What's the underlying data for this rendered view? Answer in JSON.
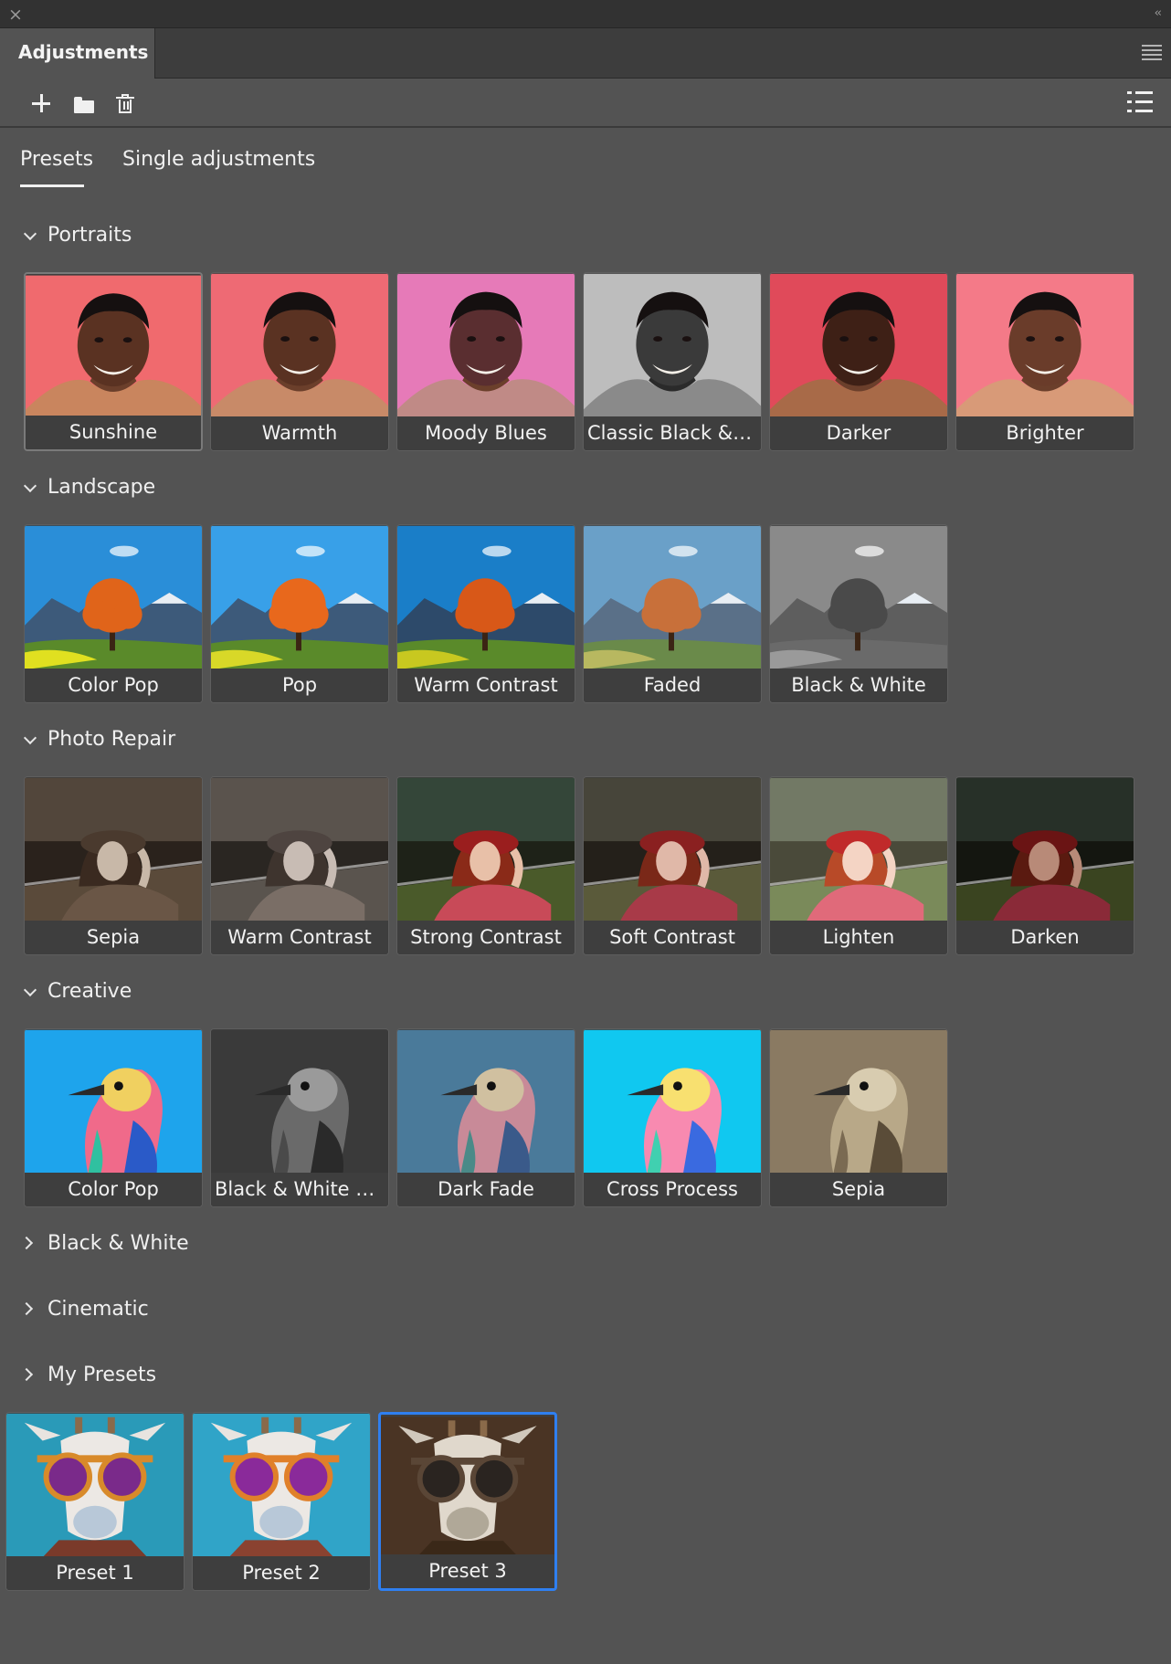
{
  "panel": {
    "title": "Adjustments",
    "close": "×",
    "collapse": "‹‹"
  },
  "toolbar": {
    "icons": [
      "plus-icon",
      "folder-icon",
      "trash-icon",
      "list-view-icon"
    ]
  },
  "tabs": {
    "presets": "Presets",
    "single": "Single adjustments",
    "active": "Presets"
  },
  "sections": {
    "portraits": {
      "title": "Portraits",
      "expanded": true,
      "items": [
        "Sunshine",
        "Warmth",
        "Moody Blues",
        "Classic Black & W...",
        "Darker",
        "Brighter"
      ]
    },
    "landscape": {
      "title": "Landscape",
      "expanded": true,
      "items": [
        "Color Pop",
        "Pop",
        "Warm Contrast",
        "Faded",
        "Black & White"
      ]
    },
    "photo_repair": {
      "title": "Photo Repair",
      "expanded": true,
      "items": [
        "Sepia",
        "Warm Contrast",
        "Strong Contrast",
        "Soft Contrast",
        "Lighten",
        "Darken"
      ]
    },
    "creative": {
      "title": "Creative",
      "expanded": true,
      "items": [
        "Color Pop",
        "Black & White Ne...",
        "Dark Fade",
        "Cross Process",
        "Sepia"
      ]
    },
    "black_white": {
      "title": "Black & White",
      "expanded": false
    },
    "cinematic": {
      "title": "Cinematic",
      "expanded": false
    },
    "my_presets": {
      "title": "My Presets",
      "expanded": false,
      "items": [
        "Preset 1",
        "Preset 2",
        "Preset 3"
      ],
      "selected": "Preset 3"
    }
  },
  "colors": {
    "panel_bg": "#535353",
    "selection": "#2f7ff0"
  }
}
